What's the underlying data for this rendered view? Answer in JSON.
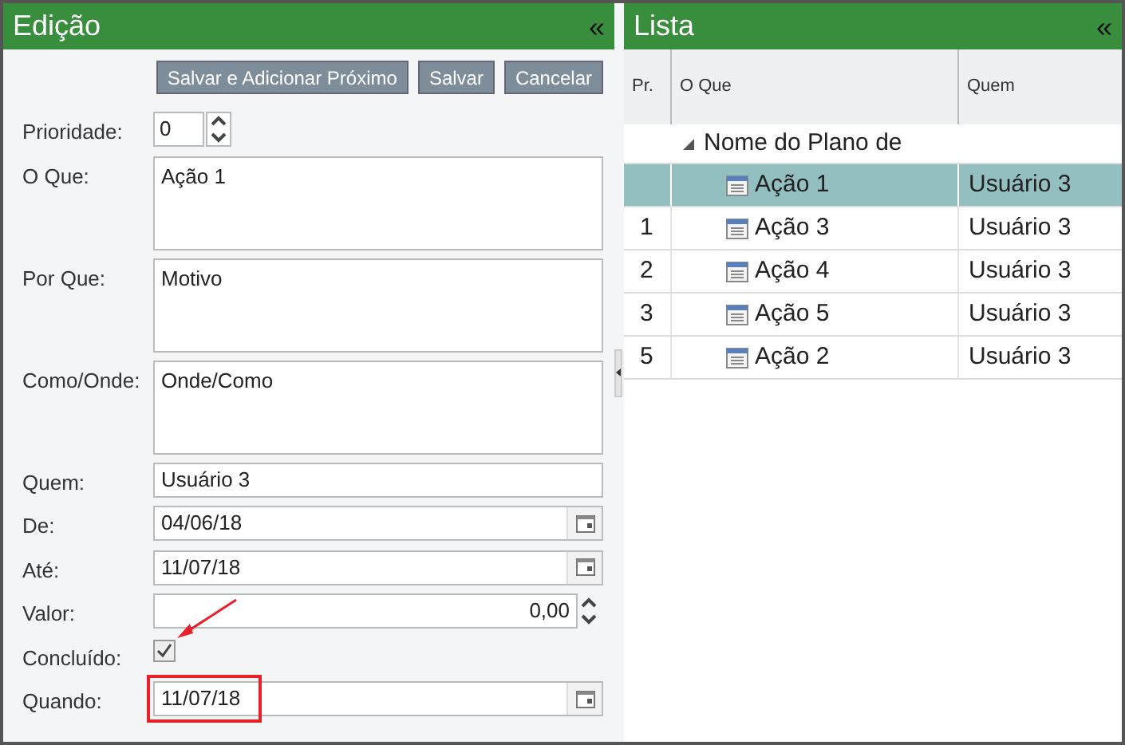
{
  "edit_panel": {
    "title": "Edição",
    "collapse": "«",
    "buttons": [
      "Salvar e Adicionar Próximo",
      "Salvar",
      "Cancelar"
    ],
    "fields": [
      {
        "kind": "spinner",
        "label": "Prioridade:",
        "value": "0"
      },
      {
        "kind": "textarea",
        "label": "O Que:",
        "value": "Ação 1"
      },
      {
        "kind": "textarea",
        "label": "Por Que:",
        "value": "Motivo"
      },
      {
        "kind": "textarea",
        "label": "Como/Onde:",
        "value": "Onde/Como"
      },
      {
        "kind": "text",
        "label": "Quem:",
        "value": "Usuário 3"
      },
      {
        "kind": "date",
        "label": "De:",
        "value": "04/06/18"
      },
      {
        "kind": "date",
        "label": "Até:",
        "value": "11/07/18"
      },
      {
        "kind": "number",
        "label": "Valor:",
        "value": "0,00"
      },
      {
        "kind": "checkbox",
        "label": "Concluído:",
        "checked": true
      },
      {
        "kind": "date",
        "label": "Quando:",
        "value": "11/07/18",
        "highlighted": true
      }
    ]
  },
  "list_panel": {
    "title": "Lista",
    "collapse": "«",
    "columns": [
      "Pr.",
      "O Que",
      "Quem"
    ],
    "rows": [
      {
        "label": "Nome do Plano de",
        "expanded": true,
        "children": [
          {
            "label": "Ação 1",
            "quem": "Usuário 3",
            "selected": true
          },
          {
            "pr": "1",
            "label": "Ação 3",
            "quem": "Usuário 3",
            "selected": false
          },
          {
            "pr": "2",
            "label": "Ação 4",
            "quem": "Usuário 3",
            "selected": false
          },
          {
            "pr": "3",
            "label": "Ação 5",
            "quem": "Usuário 3",
            "selected": false
          },
          {
            "pr": "5",
            "label": "Ação 2",
            "quem": "Usuário 3",
            "selected": false
          }
        ]
      }
    ]
  }
}
